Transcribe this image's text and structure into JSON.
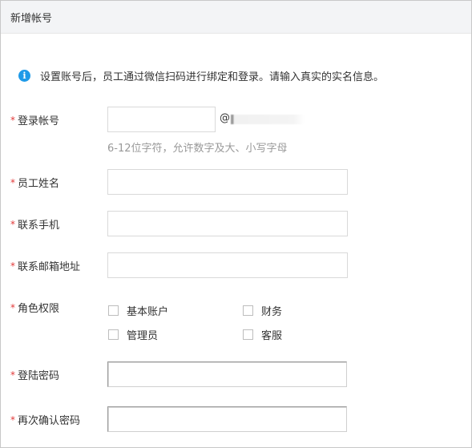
{
  "dialog": {
    "title": "新增帐号"
  },
  "notice": {
    "icon": "info-icon",
    "text": "设置账号后，员工通过微信扫码进行绑定和登录。请输入真实的实名信息。"
  },
  "form": {
    "required_mark": "*",
    "login_account": {
      "label": "登录帐号",
      "value": "",
      "at_sign": "@",
      "hint": "6-12位字符，允许数字及大、小写字母"
    },
    "employee_name": {
      "label": "员工姓名",
      "value": ""
    },
    "phone": {
      "label": "联系手机",
      "value": ""
    },
    "email": {
      "label": "联系邮箱地址",
      "value": ""
    },
    "role": {
      "label": "角色权限",
      "options": [
        {
          "label": "基本账户",
          "checked": false
        },
        {
          "label": "财务",
          "checked": false
        },
        {
          "label": "管理员",
          "checked": false
        },
        {
          "label": "客服",
          "checked": false
        }
      ]
    },
    "password": {
      "label": "登陆密码",
      "value": ""
    },
    "confirm_password": {
      "label": "再次确认密码",
      "value": ""
    }
  },
  "colors": {
    "required": "#e23a3a",
    "info_icon": "#1e9ae8",
    "hint_text": "#999999",
    "header_bg": "#f3f4f6"
  }
}
